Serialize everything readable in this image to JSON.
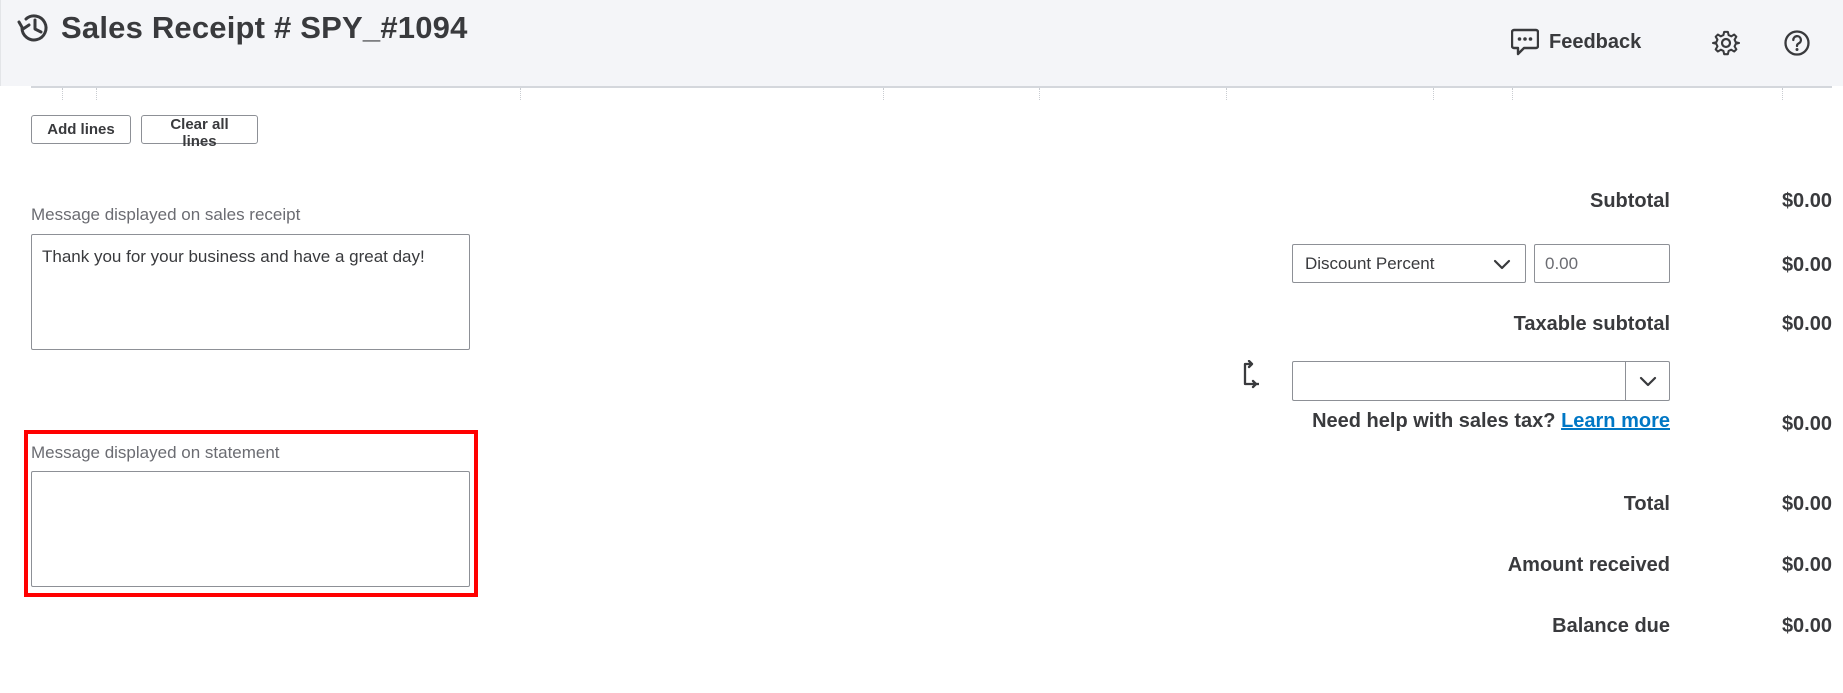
{
  "header": {
    "title": "Sales Receipt # SPY_#1094",
    "feedback_label": "Feedback",
    "icons": [
      "history-icon",
      "feedback-icon",
      "gear-icon",
      "help-icon"
    ]
  },
  "table_actions": {
    "add_lines": "Add lines",
    "clear_all_lines": "Clear all lines"
  },
  "messages": {
    "sales_receipt_label": "Message displayed on sales receipt",
    "sales_receipt_value": "Thank you for your business and have a great day!",
    "statement_label": "Message displayed on statement",
    "statement_value": ""
  },
  "totals": {
    "subtotal_label": "Subtotal",
    "subtotal_value": "$0.00",
    "discount_type": "Discount Percent",
    "discount_input_value": "0.00",
    "discount_value": "$0.00",
    "taxable_subtotal_label": "Taxable subtotal",
    "taxable_subtotal_value": "$0.00",
    "tax_rate_selected": "",
    "sales_tax_help": "Need help with sales tax?",
    "learn_more": "Learn more",
    "sales_tax_value": "$0.00",
    "total_label": "Total",
    "total_value": "$0.00",
    "amount_received_label": "Amount received",
    "amount_received_value": "$0.00",
    "balance_due_label": "Balance due",
    "balance_due_value": "$0.00"
  },
  "colors": {
    "header_bg": "#f4f5f8",
    "text": "#393a3d",
    "muted_text": "#6b6c72",
    "link": "#0077c5",
    "highlight": "#ff0000"
  }
}
